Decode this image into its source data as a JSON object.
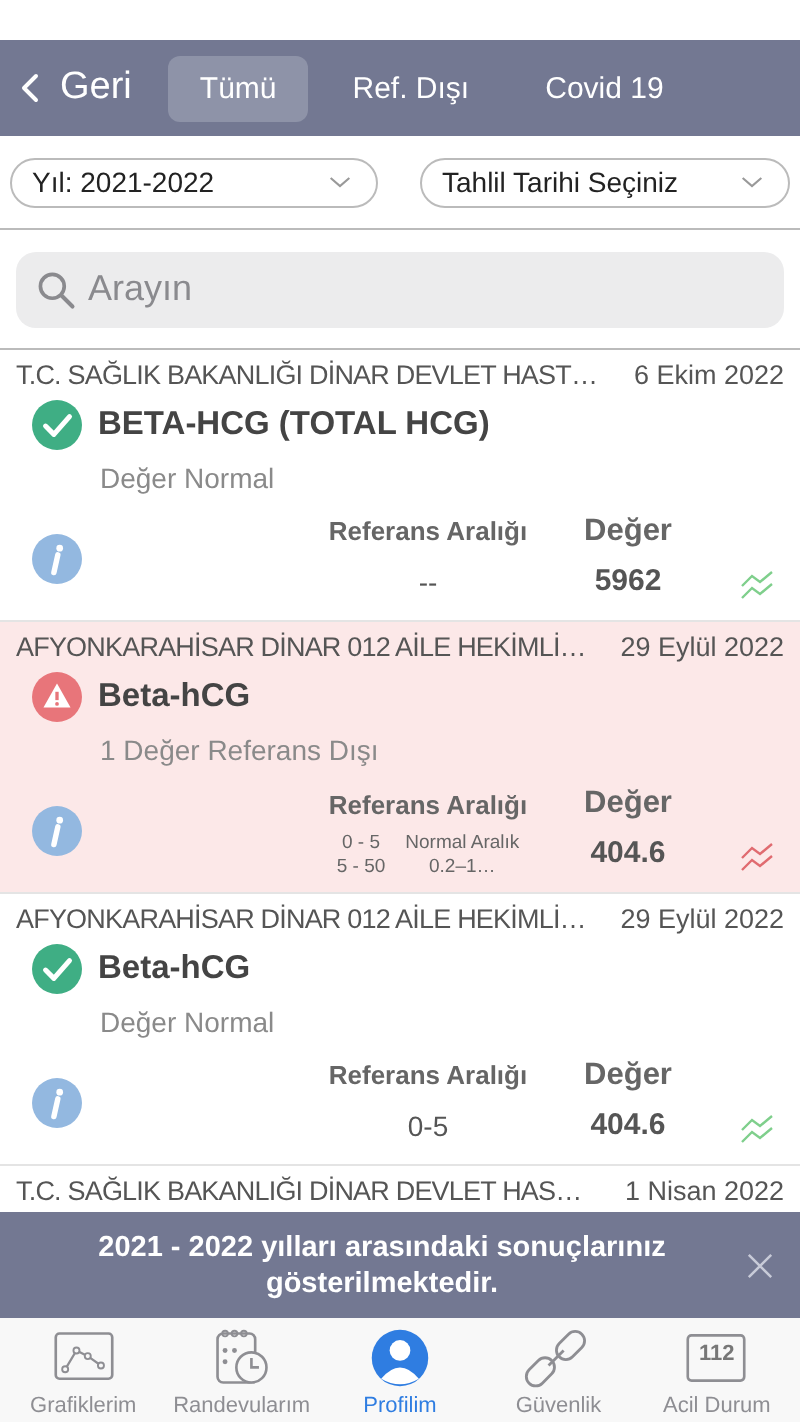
{
  "nav": {
    "back": "Geri",
    "tabs": [
      {
        "label": "Tümü",
        "selected": true
      },
      {
        "label": "Ref. Dışı",
        "selected": false
      },
      {
        "label": "Covid 19",
        "selected": false
      }
    ]
  },
  "filters": [
    {
      "value": "Yıl: 2021-2022"
    },
    {
      "value": "Tahlil Tarihi Seçiniz"
    }
  ],
  "search": {
    "placeholder": "Arayın"
  },
  "results": [
    {
      "source": "T.C. SAĞLIK BAKANLIĞI DİNAR DEVLET HAST…",
      "date": "6 Ekim 2022",
      "test": "BETA-HCG (TOTAL HCG)",
      "kind": "normal",
      "summary": "Değer Normal",
      "reference_label": "Referans Aralığı",
      "value_label": "Değer",
      "reference": [
        "--"
      ],
      "value": "5962"
    },
    {
      "source": "AFYONKARAHİSAR DİNAR 012 AİLE HEKİMLİ…",
      "date": "29 Eylül 2022",
      "test": "Beta-hCG",
      "kind": "warning",
      "summary": "1 Değer Referans Dışı",
      "reference_label": "Referans Aralığı",
      "value_label": "Değer",
      "reference": [
        "0 - 5",
        "Normal Aralık",
        "5 - 50",
        "0.2–1…"
      ],
      "value": "404.6"
    },
    {
      "source": "AFYONKARAHİSAR DİNAR 012 AİLE HEKİMLİ…",
      "date": "29 Eylül 2022",
      "test": "Beta-hCG",
      "kind": "normal",
      "summary": "Değer Normal",
      "reference_label": "Referans Aralığı",
      "value_label": "Değer",
      "reference": [
        "0-5"
      ],
      "value": "404.6"
    },
    {
      "source": "T.C. SAĞLIK BAKANLIĞI DİNAR DEVLET HAS…",
      "date": "1 Nisan 2022"
    }
  ],
  "banner": {
    "message": "2021 - 2022 yılları arasındaki sonuçlarınız gösterilmektedir."
  },
  "tabbar": [
    {
      "label": "Grafiklerim",
      "selected": false
    },
    {
      "label": "Randevularım",
      "selected": false
    },
    {
      "label": "Profilim",
      "selected": true
    },
    {
      "label": "Güvenlik",
      "selected": false
    },
    {
      "label": "Acil Durum",
      "badge": "112",
      "selected": false
    }
  ]
}
